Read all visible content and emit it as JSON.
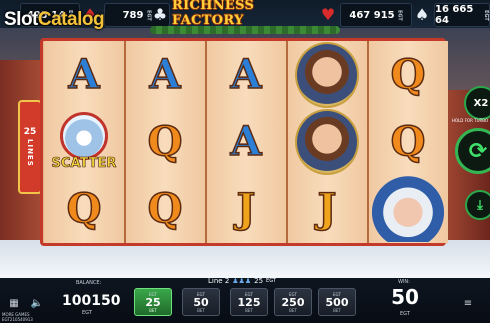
{
  "watermark": {
    "slot": "Slot",
    "catalog": "Catalog"
  },
  "topbar": {
    "title": "RICHNESS FACTORY",
    "jackpots": [
      {
        "value": "425 14",
        "currency": "EGT"
      },
      {
        "value": "789",
        "currency": "EGT"
      },
      {
        "value": "467 915",
        "currency": "EGT"
      },
      {
        "value": "16 665 64",
        "currency": "EGT"
      }
    ],
    "suits": [
      "diamond-icon",
      "club-icon",
      "heart-icon",
      "spade-icon"
    ]
  },
  "left_panel": {
    "number": "25",
    "label": "LINES"
  },
  "reels": [
    [
      "A",
      "SCATTER",
      "Q"
    ],
    [
      "A",
      "Q",
      "Q"
    ],
    [
      "A",
      "A",
      "J"
    ],
    [
      "LADY",
      "LADY",
      "J"
    ],
    [
      "Q",
      "Q",
      "ELF"
    ]
  ],
  "scatter_label": "SCATTER",
  "controls": {
    "multiplier": "X2",
    "hold_label": "HOLD FOR TURBO",
    "spin_icon": "refresh-icon",
    "download_icon": "download-icon"
  },
  "bottom": {
    "balance_label": "BALANCE:",
    "balance_value": "100150",
    "balance_currency": "EGT",
    "line_label": "Line 2",
    "line_value": "25",
    "line_currency": "EGT",
    "bets": [
      {
        "currency": "EGT",
        "value": "25",
        "label": "BET",
        "selected": true
      },
      {
        "currency": "EGT",
        "value": "50",
        "label": "BET",
        "selected": false
      },
      {
        "currency": "EGT",
        "value": "125",
        "label": "BET",
        "selected": false
      },
      {
        "currency": "EGT",
        "value": "250",
        "label": "BET",
        "selected": false
      },
      {
        "currency": "EGT",
        "value": "500",
        "label": "BET",
        "selected": false
      }
    ],
    "win_label": "WIN:",
    "win_value": "50",
    "win_currency": "EGT",
    "more_games": "MORE GAMES",
    "game_id": "EGT210540913"
  }
}
